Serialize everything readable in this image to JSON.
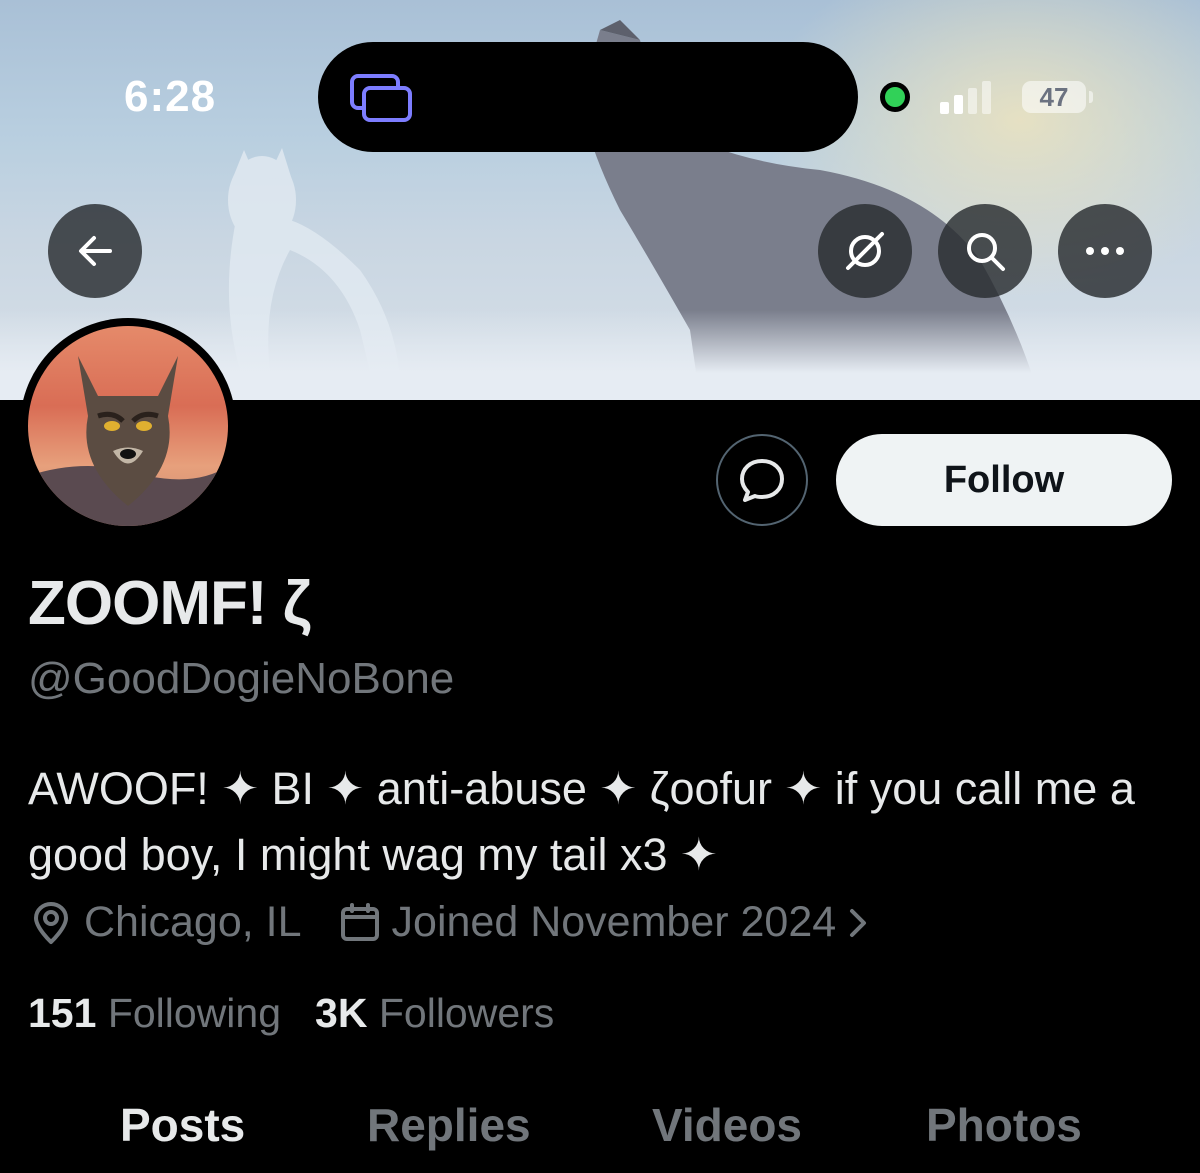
{
  "status_bar": {
    "time": "6:28",
    "battery": "47"
  },
  "banner": {
    "colors": {
      "sky": "#b9cfe0",
      "glow": "#eee4be"
    }
  },
  "profile": {
    "display_name": "ZOOMF! ζ",
    "handle": "@GoodDogieNoBone",
    "bio": "AWOOF! ✦ BI ✦ anti-abuse ✦ ζoofur ✦ if you call me a good boy, I might wag my tail x3 ✦",
    "location": "Chicago, IL",
    "joined": "Joined November 2024",
    "following_count": "151",
    "following_label": "Following",
    "followers_count": "3K",
    "followers_label": "Followers"
  },
  "actions": {
    "follow_label": "Follow"
  },
  "tabs": [
    {
      "label": "Posts"
    },
    {
      "label": "Replies"
    },
    {
      "label": "Videos"
    },
    {
      "label": "Photos"
    }
  ],
  "colors": {
    "background": "#000000",
    "text": "#e7e9ea",
    "muted": "#71767b",
    "follow_bg": "#eff3f4"
  }
}
